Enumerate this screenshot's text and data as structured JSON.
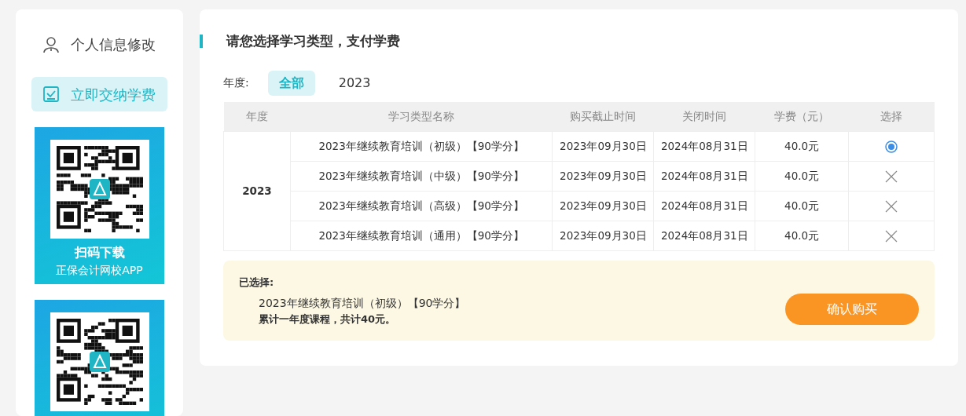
{
  "sidebar": {
    "items": [
      {
        "label": "个人信息修改",
        "kind": "person",
        "selected": false
      },
      {
        "label": "立即交纳学费",
        "kind": "checklist",
        "selected": true
      }
    ],
    "banners": [
      {
        "kind": "qr",
        "heading": "扫码下载",
        "caption": "正保会计网校APP"
      },
      {
        "kind": "qr"
      }
    ]
  },
  "main": {
    "title": "请您选择学习类型，支付学费",
    "filter": {
      "label": "年度:",
      "options": [
        {
          "label": "全部",
          "selected": true
        },
        {
          "label": "2023",
          "selected": false
        }
      ]
    },
    "table": {
      "columns": [
        "年度",
        "学习类型名称",
        "购买截止时间",
        "关闭时间",
        "学费（元）",
        "选择"
      ],
      "groups": [
        {
          "year": "2023",
          "rows": [
            {
              "name": "2023年继续教育培训（初级）【90学分】",
              "deadline": "2023年09月30日",
              "close": "2024年08月31日",
              "fee": "40.0元",
              "available": true,
              "selected": true
            },
            {
              "name": "2023年继续教育培训（中级）【90学分】",
              "deadline": "2023年09月30日",
              "close": "2024年08月31日",
              "fee": "40.0元",
              "available": false
            },
            {
              "name": "2023年继续教育培训（高级）【90学分】",
              "deadline": "2023年09月30日",
              "close": "2024年08月31日",
              "fee": "40.0元",
              "available": false
            },
            {
              "name": "2023年继续教育培训（通用）【90学分】",
              "deadline": "2023年09月30日",
              "close": "2024年08月31日",
              "fee": "40.0元",
              "available": false
            }
          ]
        }
      ]
    },
    "summary": {
      "label": "已选择:",
      "item": "2023年继续教育培训（初级）【90学分】",
      "total": "累计一年度课程，共计40元。",
      "button": "确认购买"
    }
  }
}
